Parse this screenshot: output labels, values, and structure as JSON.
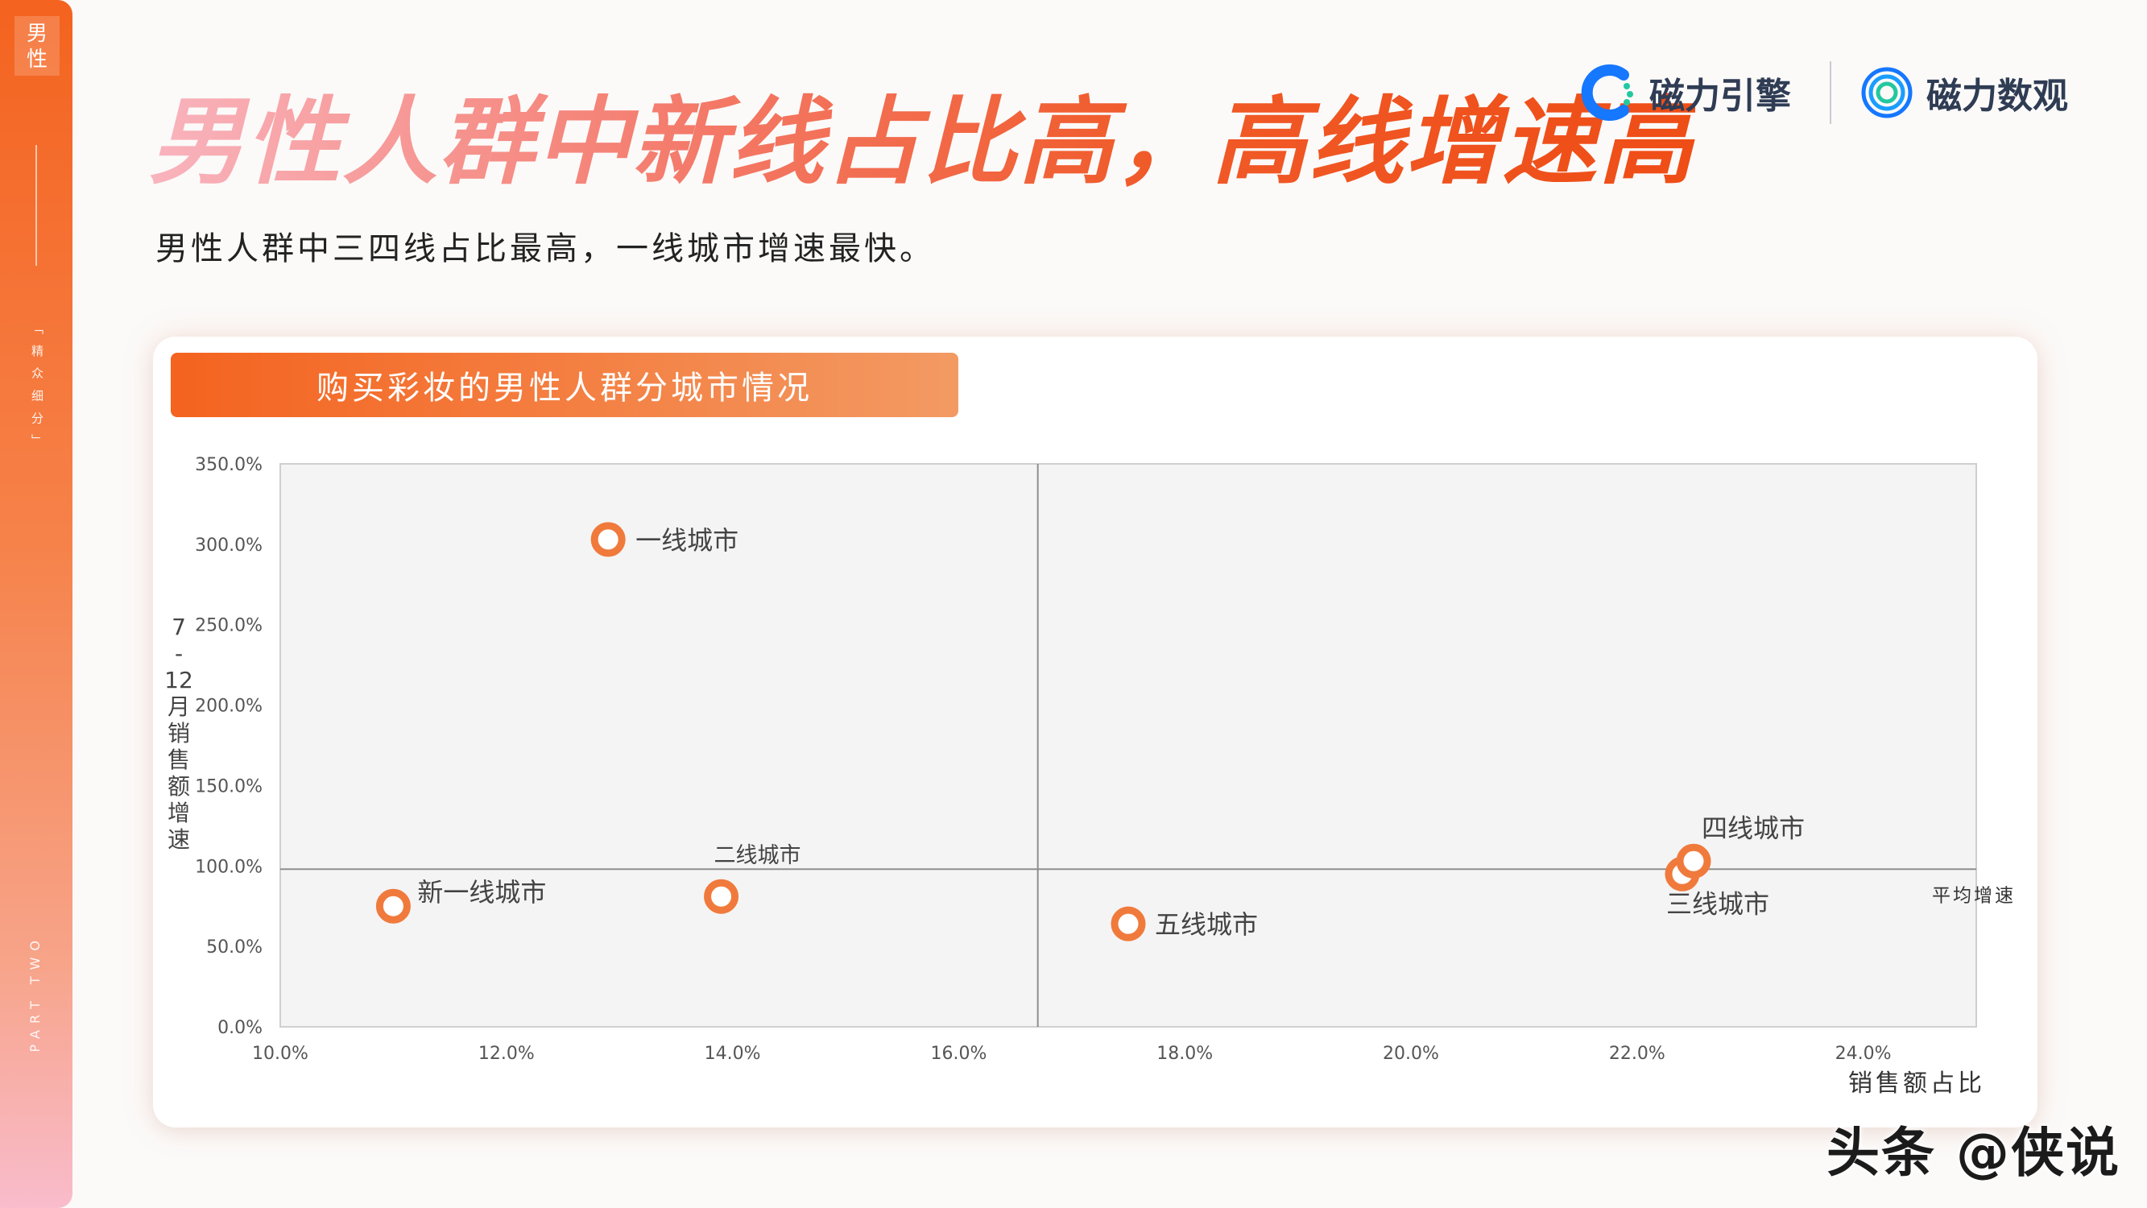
{
  "sidebar": {
    "tag": "男 性",
    "section_label": "「 精 众 细 分 」",
    "part_label": "PART TWO"
  },
  "header": {
    "title": "男性人群中新线占比高，高线增速高",
    "subtitle": "男性人群中三四线占比最高，一线城市增速最快。"
  },
  "logos": [
    {
      "name": "磁力引擎",
      "icon": "c-brand-icon",
      "color": "#1677ff"
    },
    {
      "name": "磁力数观",
      "icon": "ring-brand-icon",
      "color": "#1677ff"
    }
  ],
  "card": {
    "title": "购买彩妆的男性人群分城市情况"
  },
  "chart_data": {
    "type": "scatter",
    "title": "购买彩妆的男性人群分城市情况",
    "xlabel": "销售额占比",
    "ylabel": "7-12月销售额增速",
    "xlim": [
      0.1,
      0.25
    ],
    "ylim": [
      0.0,
      3.5
    ],
    "xticks": [
      "10.0%",
      "12.0%",
      "14.0%",
      "16.0%",
      "18.0%",
      "20.0%",
      "22.0%",
      "24.0%"
    ],
    "yticks": [
      "0.0%",
      "50.0%",
      "100.0%",
      "150.0%",
      "200.0%",
      "250.0%",
      "300.0%",
      "350.0%"
    ],
    "reference_lines": {
      "vertical_x": 0.167,
      "horizontal_y": 0.98,
      "horizontal_label": "平均增速"
    },
    "points": [
      {
        "label": "一线城市",
        "x": 0.129,
        "y": 3.03
      },
      {
        "label": "新一线城市",
        "x": 0.11,
        "y": 0.75
      },
      {
        "label": "二线城市",
        "x": 0.139,
        "y": 0.81
      },
      {
        "label": "五线城市",
        "x": 0.175,
        "y": 0.64
      },
      {
        "label": "三线城市",
        "x": 0.224,
        "y": 0.95
      },
      {
        "label": "四线城市",
        "x": 0.225,
        "y": 1.03
      }
    ],
    "marker_color": "#f07a3c",
    "plot_bg": "#f4f4f4",
    "grid": false
  },
  "watermark": "头条 @侠说"
}
